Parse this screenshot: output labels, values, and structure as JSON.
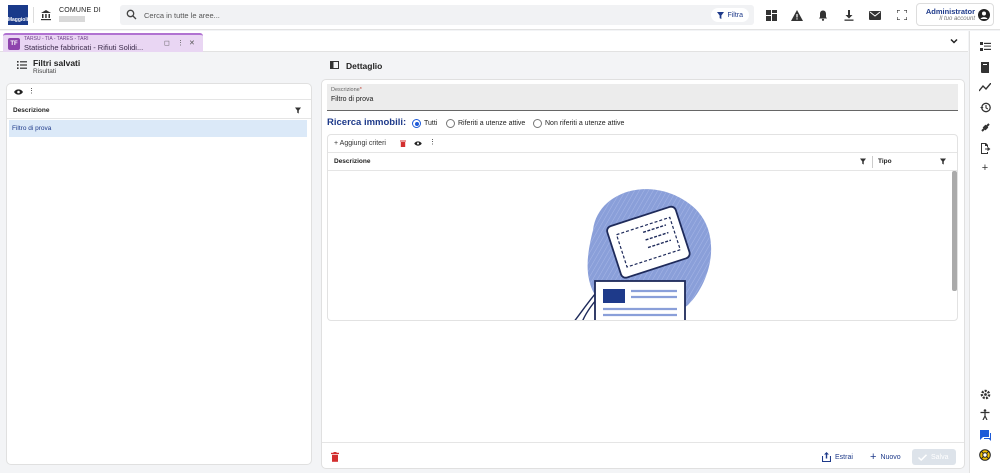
{
  "app": {
    "logo_text": "Maggioli",
    "org_label": "COMUNE DI"
  },
  "search": {
    "placeholder": "Cerca in tutte le aree...",
    "filter_label": "Filtra"
  },
  "toolbar_icons": [
    "dashboard-icon",
    "warning-icon",
    "bell-icon",
    "download-icon",
    "mail-icon",
    "fullscreen-icon"
  ],
  "account": {
    "name": "Administrator",
    "subtitle": "Il tuo account"
  },
  "tab": {
    "icon_letters": "TF",
    "category": "TARSU - TIA - TARES - TARI",
    "title": "Statistiche fabbricati - Rifiuti Solidi..."
  },
  "left": {
    "title": "Filtri salvati",
    "subtitle": "Risultati",
    "column": "Descrizione",
    "rows": [
      "Filtro di prova"
    ]
  },
  "right": {
    "title": "Dettaglio",
    "field_label": "Descrizione",
    "field_value": "Filtro di prova",
    "ricerca_label": "Ricerca immobili:",
    "radios": [
      {
        "label": "Tutti",
        "selected": true
      },
      {
        "label": "Riferiti a utenze attive",
        "selected": false
      },
      {
        "label": "Non riferiti a utenze attive",
        "selected": false
      }
    ],
    "add_criteria": "Aggiungi criteri",
    "columns": [
      "Descrizione",
      "Tipo"
    ],
    "buttons": {
      "estrai": "Estrai",
      "nuovo": "Nuovo",
      "salva": "Salva"
    }
  },
  "colors": {
    "brand": "#1e3a8a",
    "tab_accent": "#b072d1",
    "selected_row": "#dbe9f8",
    "illustration": "#8a9fd9"
  }
}
